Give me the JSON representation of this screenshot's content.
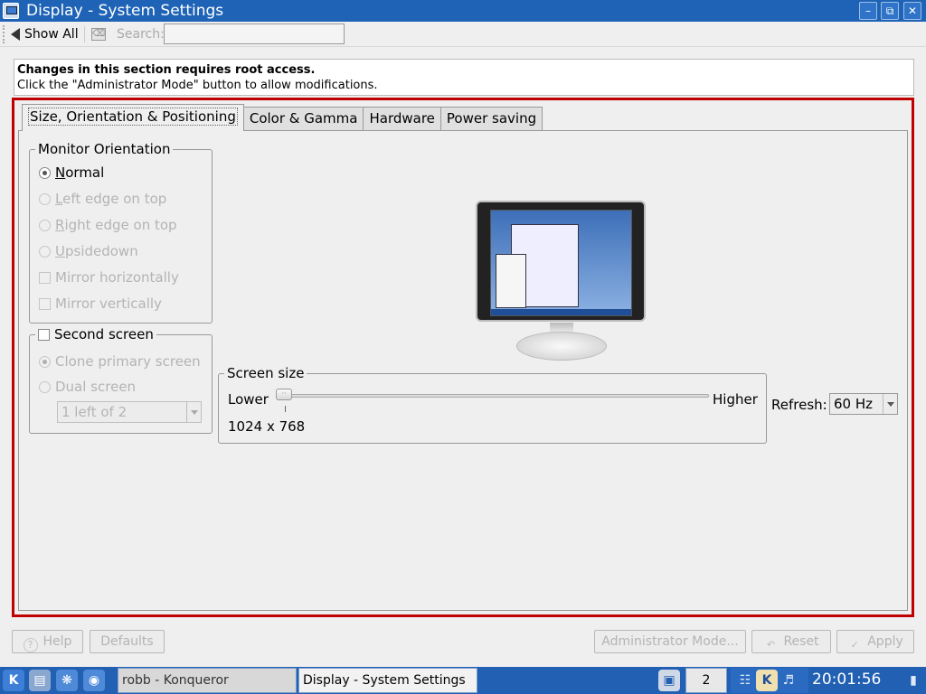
{
  "window": {
    "title": "Display - System Settings",
    "buttons": [
      "minimize",
      "maximize",
      "close"
    ]
  },
  "toolbar": {
    "show_all_label": "Show All",
    "search_label": "Search:",
    "search_value": ""
  },
  "notice": {
    "line1": "Changes in this section requires root access.",
    "line2": "Click the \"Administrator Mode\" button to allow modifications."
  },
  "tabs": [
    {
      "label": "Size, Orientation & Positioning",
      "active": true
    },
    {
      "label": "Color & Gamma",
      "active": false
    },
    {
      "label": "Hardware",
      "active": false
    },
    {
      "label": "Power saving",
      "active": false
    }
  ],
  "orientation": {
    "title": "Monitor Orientation",
    "options": [
      {
        "label": "Normal",
        "type": "radio",
        "checked": true,
        "enabled": true
      },
      {
        "label": "Left edge on top",
        "type": "radio",
        "checked": false,
        "enabled": false
      },
      {
        "label": "Right edge on top",
        "type": "radio",
        "checked": false,
        "enabled": false
      },
      {
        "label": "Upsidedown",
        "type": "radio",
        "checked": false,
        "enabled": false
      },
      {
        "label": "Mirror horizontally",
        "type": "checkbox",
        "checked": false,
        "enabled": false
      },
      {
        "label": "Mirror vertically",
        "type": "checkbox",
        "checked": false,
        "enabled": false
      }
    ]
  },
  "second_screen": {
    "title": "Second screen",
    "checked": false,
    "options": [
      {
        "label": "Clone primary screen",
        "checked": true,
        "enabled": false
      },
      {
        "label": "Dual screen",
        "checked": false,
        "enabled": false
      }
    ],
    "position_value": "1 left of 2"
  },
  "screen_size": {
    "title": "Screen size",
    "lower_label": "Lower",
    "higher_label": "Higher",
    "current": "1024 x 768",
    "slider_value": 0
  },
  "refresh": {
    "label": "Refresh:",
    "value": "60 Hz"
  },
  "bottom_buttons": {
    "help": "Help",
    "defaults": "Defaults",
    "admin_mode": "Administrator Mode...",
    "reset": "Reset",
    "apply": "Apply"
  },
  "taskbar": {
    "tasks": [
      {
        "label": "robb - Konqueror",
        "active": false
      },
      {
        "label": "Display - System Settings",
        "active": true
      }
    ],
    "pager_value": "2",
    "clock": "20:01:56"
  },
  "colors": {
    "titlebar": "#1e63b6",
    "taskbar": "#2160b3",
    "frame_highlight": "#c00000"
  }
}
